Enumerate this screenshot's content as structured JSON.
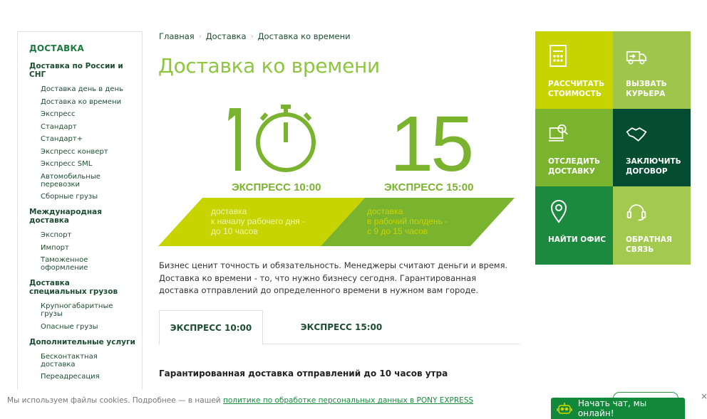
{
  "breadcrumb": [
    "Главная",
    "Доставка",
    "Доставка ко времени"
  ],
  "page_title": "Доставка ко времени",
  "sidebar": {
    "title": "ДОСТАВКА",
    "sections": [
      {
        "title": "Доставка по России и СНГ",
        "items": [
          "Доставка день в день",
          "Доставка ко времени",
          "Экспресс",
          "Стандарт",
          "Стандарт+",
          "Экспресс конверт",
          "Экспресс SML",
          "Автомобильные перевозки",
          "Сборные грузы"
        ]
      },
      {
        "title": "Международная доставка",
        "items": [
          "Экспорт",
          "Импорт",
          "Таможенное оформление"
        ]
      },
      {
        "title": "Доставка специальных грузов",
        "items": [
          "Крупногабаритные грузы",
          "Опасные грузы"
        ]
      },
      {
        "title": "Дополнительные услуги",
        "items": [
          "Бесконтактная доставка",
          "Переадресация"
        ]
      }
    ]
  },
  "hero": {
    "left_number": "10",
    "left_label": "ЭКСПРЕСС 10:00",
    "left_band": [
      "доставка",
      "к началу рабочего дня -",
      "до 10 часов"
    ],
    "right_number": "15",
    "right_label": "ЭКСПРЕСС 15:00",
    "right_band": [
      "доставка",
      "в рабочий полдень -",
      "с 9 до 15 часов"
    ]
  },
  "description": "Бизнес ценит точность и обязательность. Менеджеры считают деньги и время. Доставка ко времени - то, что нужно бизнесу сегодня. Гарантированная доставка отправлений до определенного времени в нужном вам городе.",
  "tabs": [
    "ЭКСПРЕСС 10:00",
    "ЭКСПРЕСС 15:00"
  ],
  "sub_heading": "Гарантированная доставка отправлений до 10 часов утра",
  "tiles": [
    {
      "label": "РАССЧИТАТЬ СТОИМОСТЬ",
      "icon": "calculator-icon"
    },
    {
      "label": "ВЫЗВАТЬ КУРЬЕРА",
      "icon": "truck-icon"
    },
    {
      "label": "ОТСЛЕДИТЬ ДОСТАВКУ",
      "icon": "monitor-search-icon"
    },
    {
      "label": "ЗАКЛЮЧИТЬ ДОГОВОР",
      "icon": "handshake-icon"
    },
    {
      "label": "НАЙТИ ОФИС",
      "icon": "location-pin-icon"
    },
    {
      "label": "ОБРАТНАЯ СВЯЗЬ",
      "icon": "headset-icon"
    }
  ],
  "cookie": {
    "text": "Мы используем файлы cookies. Подробнее — в нашей ",
    "link": "политике по обработке персональных данных в PONY EXPRESS",
    "close": "×"
  },
  "chat": {
    "label": "Начать чат, мы онлайн!"
  },
  "colors": {
    "lime": "#c8d400",
    "green": "#7ab32e",
    "dark_green": "#054d32",
    "title_green": "#8dc63f"
  }
}
